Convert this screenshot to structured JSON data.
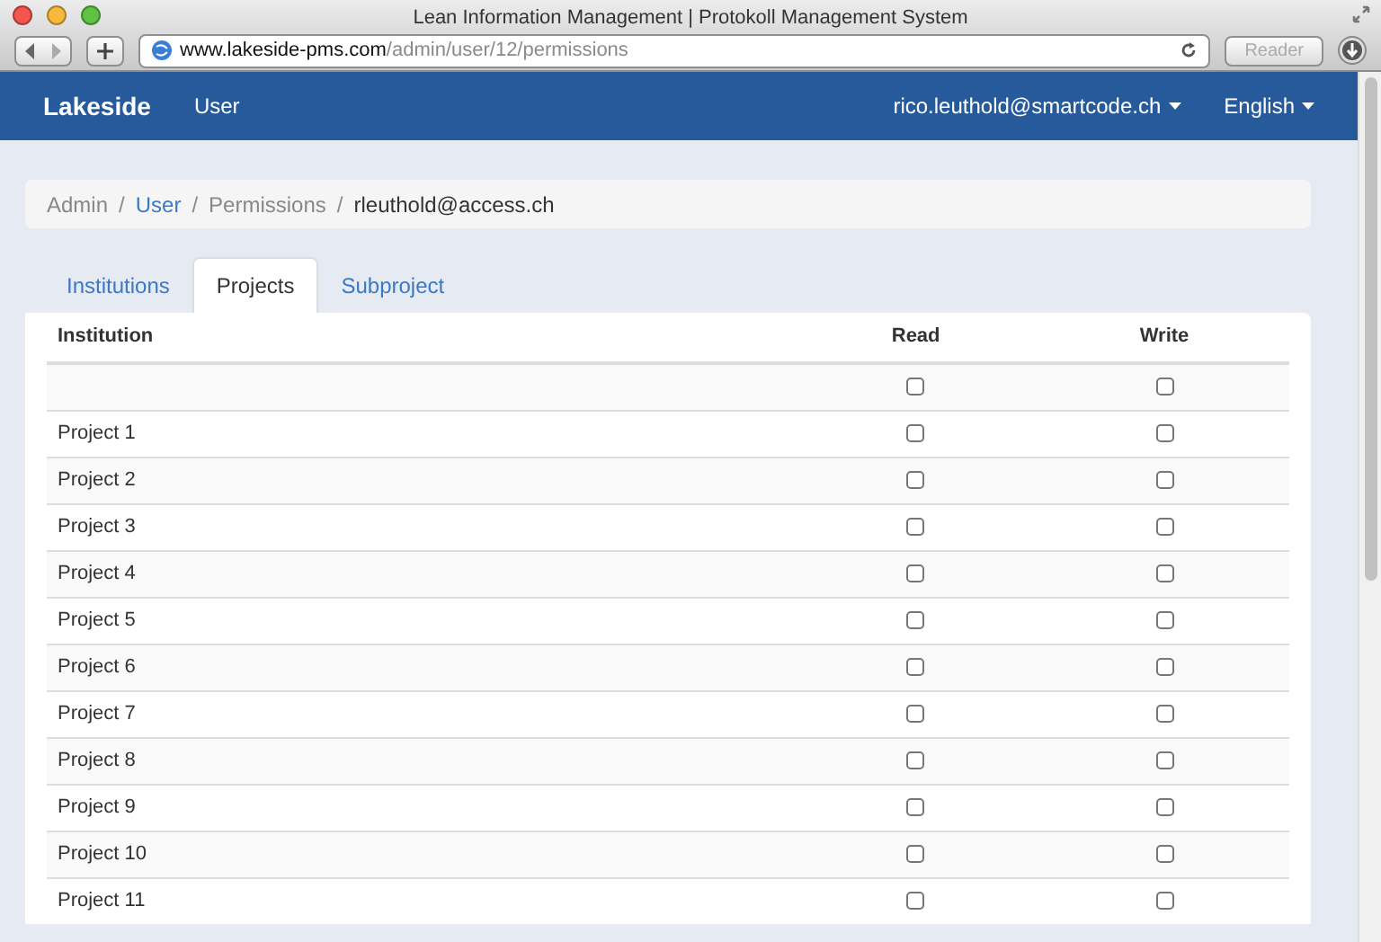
{
  "window": {
    "title": "Lean Information Management | Protokoll Management System"
  },
  "browser": {
    "url_host": "www.lakeside-pms.com",
    "url_path": "/admin/user/12/permissions",
    "reader": "Reader"
  },
  "navbar": {
    "brand": "Lakeside",
    "items": [
      {
        "label": "User"
      }
    ],
    "right": [
      {
        "label": "rico.leuthold@smartcode.ch",
        "dropdown": true
      },
      {
        "label": "English",
        "dropdown": true
      }
    ]
  },
  "breadcrumb_separator": "/",
  "breadcrumb": [
    {
      "label": "Admin",
      "kind": "text"
    },
    {
      "label": "User",
      "kind": "link"
    },
    {
      "label": "Permissions",
      "kind": "text"
    },
    {
      "label": "rleuthold@access.ch",
      "kind": "current"
    }
  ],
  "tabs": [
    {
      "label": "Institutions",
      "selected": false
    },
    {
      "label": "Projects",
      "selected": true
    },
    {
      "label": "Subproject",
      "selected": false
    }
  ],
  "table": {
    "columns": [
      "Institution",
      "Read",
      "Write"
    ],
    "rows": [
      {
        "name": "",
        "read": false,
        "write": false
      },
      {
        "name": "Project 1",
        "read": false,
        "write": false
      },
      {
        "name": "Project 2",
        "read": false,
        "write": false
      },
      {
        "name": "Project 3",
        "read": false,
        "write": false
      },
      {
        "name": "Project 4",
        "read": false,
        "write": false
      },
      {
        "name": "Project 5",
        "read": false,
        "write": false
      },
      {
        "name": "Project 6",
        "read": false,
        "write": false
      },
      {
        "name": "Project 7",
        "read": false,
        "write": false
      },
      {
        "name": "Project 8",
        "read": false,
        "write": false
      },
      {
        "name": "Project 9",
        "read": false,
        "write": false
      },
      {
        "name": "Project 10",
        "read": false,
        "write": false
      },
      {
        "name": "Project 11",
        "read": false,
        "write": false
      }
    ]
  }
}
